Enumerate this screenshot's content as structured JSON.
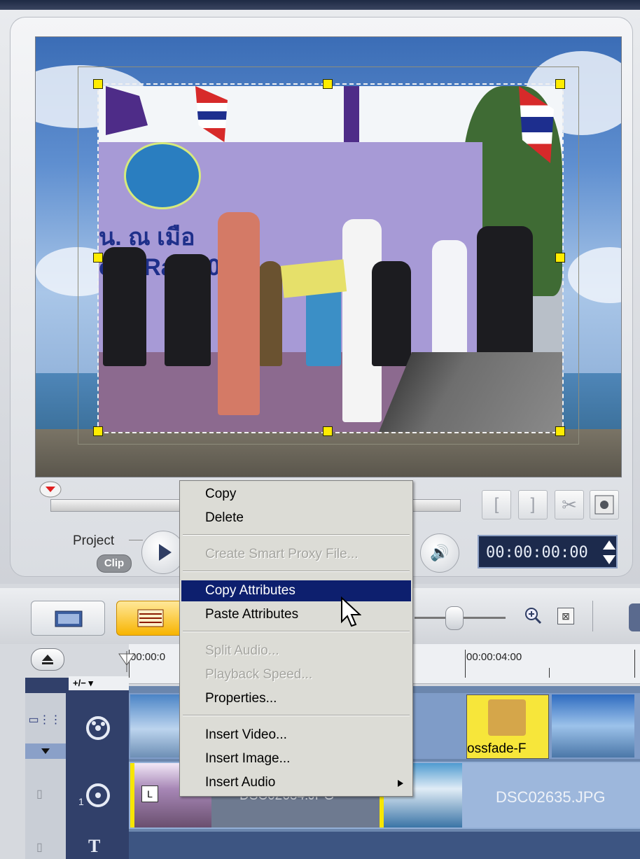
{
  "transport": {
    "project_label": "Project",
    "clip_label": "Clip",
    "timecode": "00:00:00:00",
    "trim_in_label": "[",
    "trim_out_label": "]"
  },
  "context_menu": {
    "items": [
      {
        "label": "Copy",
        "enabled": true
      },
      {
        "label": "Delete",
        "enabled": true
      },
      {
        "label": "Create Smart Proxy File...",
        "enabled": false
      },
      {
        "label": "Copy Attributes",
        "enabled": true,
        "highlighted": true
      },
      {
        "label": "Paste Attributes",
        "enabled": true
      },
      {
        "label": "Split Audio...",
        "enabled": false
      },
      {
        "label": "Playback Speed...",
        "enabled": false
      },
      {
        "label": "Properties...",
        "enabled": true
      },
      {
        "label": "Insert Video...",
        "enabled": true
      },
      {
        "label": "Insert Image...",
        "enabled": true
      },
      {
        "label": "Insert Audio",
        "enabled": true,
        "submenu": true
      }
    ]
  },
  "timeline": {
    "ruler_labels": [
      "00:00:0",
      "00:00:04:00"
    ],
    "add_remove_label": "+/− ▾",
    "transition_label": "ossfade-F",
    "clip_label_mid": "DSC02634.JPG",
    "clip_label_right": "DSC02635.JPG",
    "title_track_icon": "T"
  },
  "preview": {
    "banner_text_1": "น. ณ เมือ",
    "banner_text_2": "our Ra   2008"
  },
  "colors": {
    "menu_highlight": "#0d1f6e",
    "handle": "#ffec00",
    "timecode_bg": "#1c2a4c",
    "timeline_button_active": "#f7b400"
  }
}
